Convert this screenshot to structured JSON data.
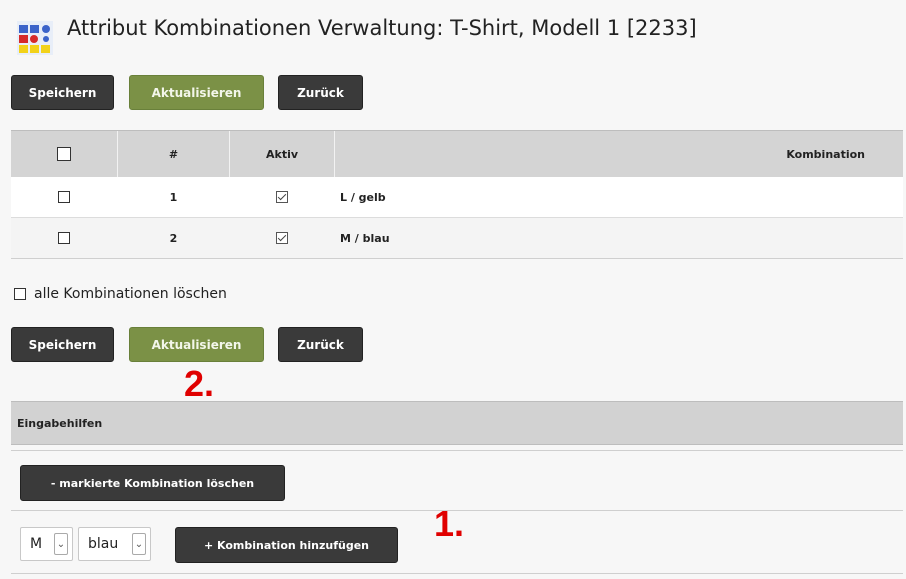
{
  "header": {
    "title": "Attribut Kombinationen Verwaltung: T-Shirt, Modell 1 [2233]",
    "icon": "attribute-matrix-icon"
  },
  "toolbar_top": {
    "save": "Speichern",
    "update": "Aktualisieren",
    "back": "Zurück"
  },
  "table": {
    "columns": [
      "#",
      "Aktiv",
      "Kombination"
    ],
    "rows": [
      {
        "num": "1",
        "active": true,
        "combination": "L / gelb"
      },
      {
        "num": "2",
        "active": true,
        "combination": "M / blau"
      }
    ]
  },
  "delete_all_label": "alle Kombinationen löschen",
  "toolbar_bottom": {
    "save": "Speichern",
    "update": "Aktualisieren",
    "back": "Zurück"
  },
  "annotations": {
    "one": "1.",
    "two": "2."
  },
  "helpers": {
    "title": "Eingabehilfen",
    "delete_marked": "- markierte Kombination löschen",
    "size_value": "M",
    "color_value": "blau",
    "add_combination": "+ Kombination hinzufügen"
  },
  "colors": {
    "dark_button": "#3a3a3a",
    "green_button": "#7b9146",
    "annotation_red": "#e00000"
  }
}
